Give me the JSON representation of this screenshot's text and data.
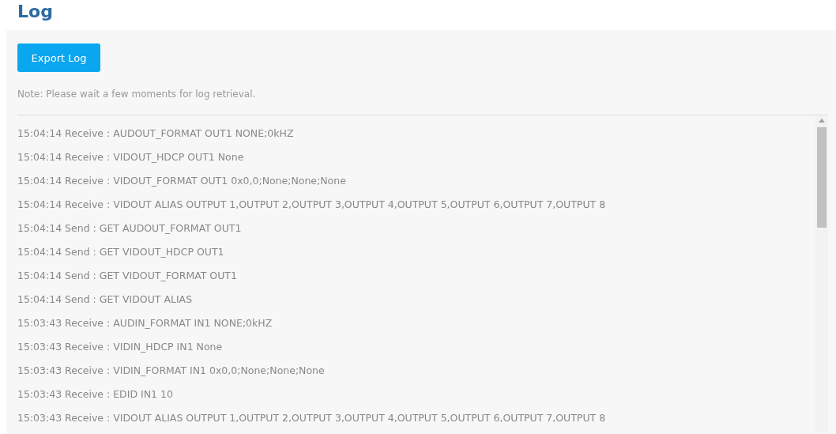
{
  "page": {
    "title": "Log"
  },
  "export_button": {
    "label": "Export Log"
  },
  "note": "Note: Please wait a few moments for log retrieval.",
  "log_lines": [
    "15:04:14 Receive : AUDOUT_FORMAT OUT1 NONE;0kHZ",
    "15:04:14 Receive : VIDOUT_HDCP OUT1 None",
    "15:04:14 Receive : VIDOUT_FORMAT OUT1 0x0,0;None;None;None",
    "15:04:14 Receive : VIDOUT ALIAS OUTPUT 1,OUTPUT 2,OUTPUT 3,OUTPUT 4,OUTPUT 5,OUTPUT 6,OUTPUT 7,OUTPUT 8",
    "15:04:14 Send : GET AUDOUT_FORMAT OUT1",
    "15:04:14 Send : GET VIDOUT_HDCP OUT1",
    "15:04:14 Send : GET VIDOUT_FORMAT OUT1",
    "15:04:14 Send : GET VIDOUT ALIAS",
    "15:03:43 Receive : AUDIN_FORMAT IN1 NONE;0kHZ",
    "15:03:43 Receive : VIDIN_HDCP IN1 None",
    "15:03:43 Receive : VIDIN_FORMAT IN1 0x0,0;None;None;None",
    "15:03:43 Receive : EDID IN1 10",
    "15:03:43 Receive : VIDOUT ALIAS OUTPUT 1,OUTPUT 2,OUTPUT 3,OUTPUT 4,OUTPUT 5,OUTPUT 6,OUTPUT 7,OUTPUT 8"
  ]
}
